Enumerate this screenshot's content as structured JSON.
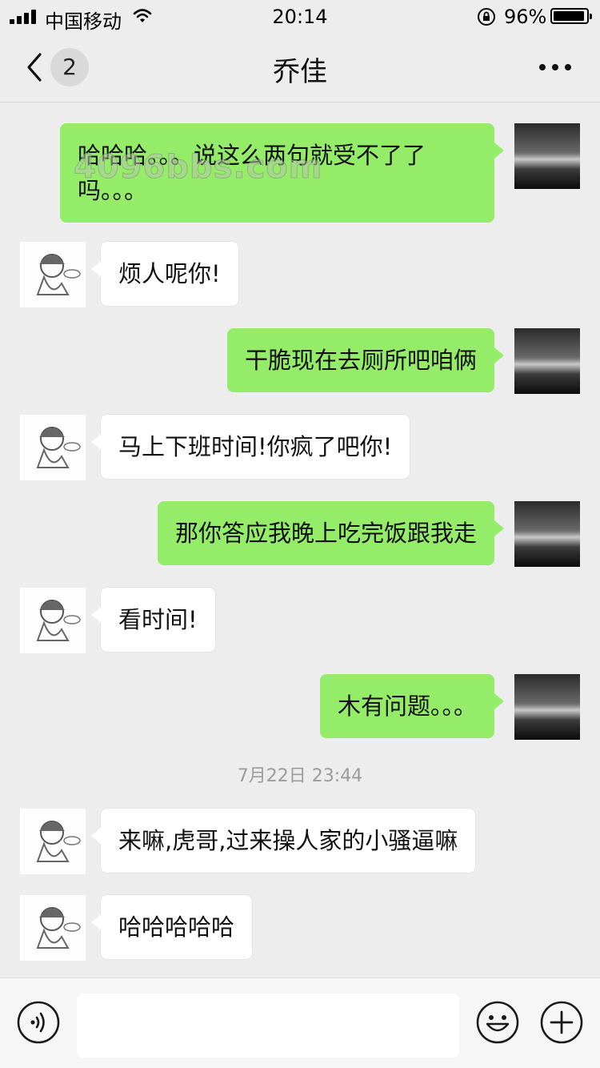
{
  "status_bar": {
    "carrier": "中国移动",
    "time": "20:14",
    "battery_percent": "96%",
    "battery_level": 0.96
  },
  "header": {
    "back_icon": "chevron-left-icon",
    "unread_count": "2",
    "title": "乔佳",
    "more_icon": "ellipsis-icon"
  },
  "messages": [
    {
      "sender": "me",
      "text": "哈哈哈。。。说这么两句就受不了了吗。。。"
    },
    {
      "sender": "contact",
      "text": "烦人呢你!"
    },
    {
      "sender": "me",
      "text": "干脆现在去厕所吧咱俩"
    },
    {
      "sender": "contact",
      "text": "马上下班时间!你疯了吧你!"
    },
    {
      "sender": "me",
      "text": "那你答应我晚上吃完饭跟我走"
    },
    {
      "sender": "contact",
      "text": "看时间!"
    },
    {
      "sender": "me",
      "text": "木有问题。。。"
    },
    {
      "sender": "contact",
      "text": "来嘛,虎哥,过来操人家的小骚逼嘛"
    },
    {
      "sender": "contact",
      "text": "哈哈哈哈哈"
    }
  ],
  "timestamp": "7月22日 23:44",
  "watermark": "4096bbs.com",
  "input_bar": {
    "voice_icon": "voice-icon",
    "input_value": "",
    "emoji_icon": "emoji-icon",
    "plus_icon": "plus-icon"
  },
  "colors": {
    "my_bubble": "#95ec69",
    "contact_bubble": "#ffffff",
    "background": "#ededed"
  }
}
